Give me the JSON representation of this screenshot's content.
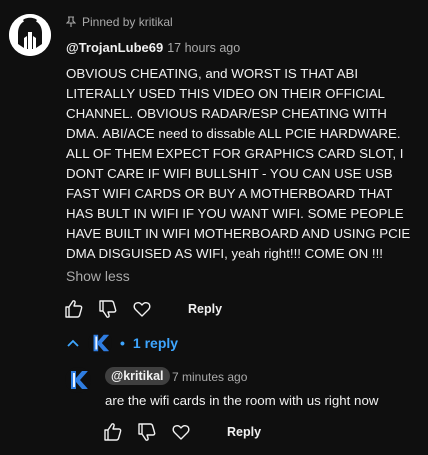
{
  "comment": {
    "pinned_label": "Pinned by kritikal",
    "author": "@TrojanLube69",
    "timestamp": "17 hours ago",
    "text": "OBVIOUS CHEATING, and WORST IS THAT ABI LITERALLY USED THIS VIDEO ON THEIR OFFICIAL CHANNEL. OBVIOUS RADAR/ESP CHEATING WITH DMA. ABI/ACE need to dissable ALL PCIE HARDWARE. ALL OF THEM EXPECT FOR GRAPHICS CARD SLOT, I DONT CARE IF WIFI BULLSHIT - YOU CAN USE USB FAST WIFI CARDS OR BUY A MOTHERBOARD THAT HAS BULT IN WIFI IF YOU WANT WIFI. SOME PEOPLE HAVE BUILT IN WIFI MOTHERBOARD AND USING PCIE DMA DISGUISED AS WIFI, yeah right!!! COME ON !!!",
    "show_less_label": "Show less",
    "reply_label": "Reply",
    "icons": [
      "like-icon",
      "dislike-icon",
      "heart-icon"
    ]
  },
  "replies_toggle": {
    "label": "1 reply",
    "separator": "•",
    "icon": "chevron-up-icon"
  },
  "reply": {
    "author": "@kritikal",
    "timestamp": "7 minutes ago",
    "text": "are the wifi cards in the room with us right now",
    "reply_label": "Reply"
  },
  "colors": {
    "background": "#0f0f0f",
    "text": "#f1f1f1",
    "secondary_text": "#aaaaaa",
    "link_blue": "#3ea6ff",
    "chip_bg": "#3f3f3f",
    "k_logo_blue": "#2f7de1"
  }
}
